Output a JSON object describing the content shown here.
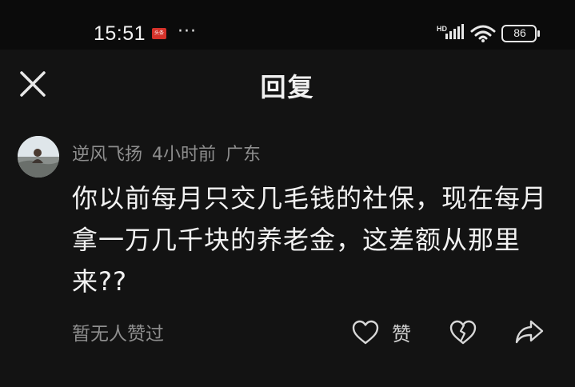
{
  "status_bar": {
    "time": "15:51",
    "app_badge": "头条",
    "more": "···",
    "network": "HD",
    "battery": "86"
  },
  "header": {
    "title": "回复"
  },
  "comment": {
    "author": "逆风飞扬",
    "time_ago": "4小时前",
    "location": "广东",
    "text": "你以前每月只交几毛钱的社保，现在每月拿一万几千块的养老金，这差额从那里来??",
    "no_likes_text": "暂无人赞过",
    "like_label": "赞"
  },
  "icons": {
    "close": "close-icon",
    "like": "heart-icon",
    "dislike": "broken-heart-icon",
    "share": "share-arrow-icon"
  }
}
